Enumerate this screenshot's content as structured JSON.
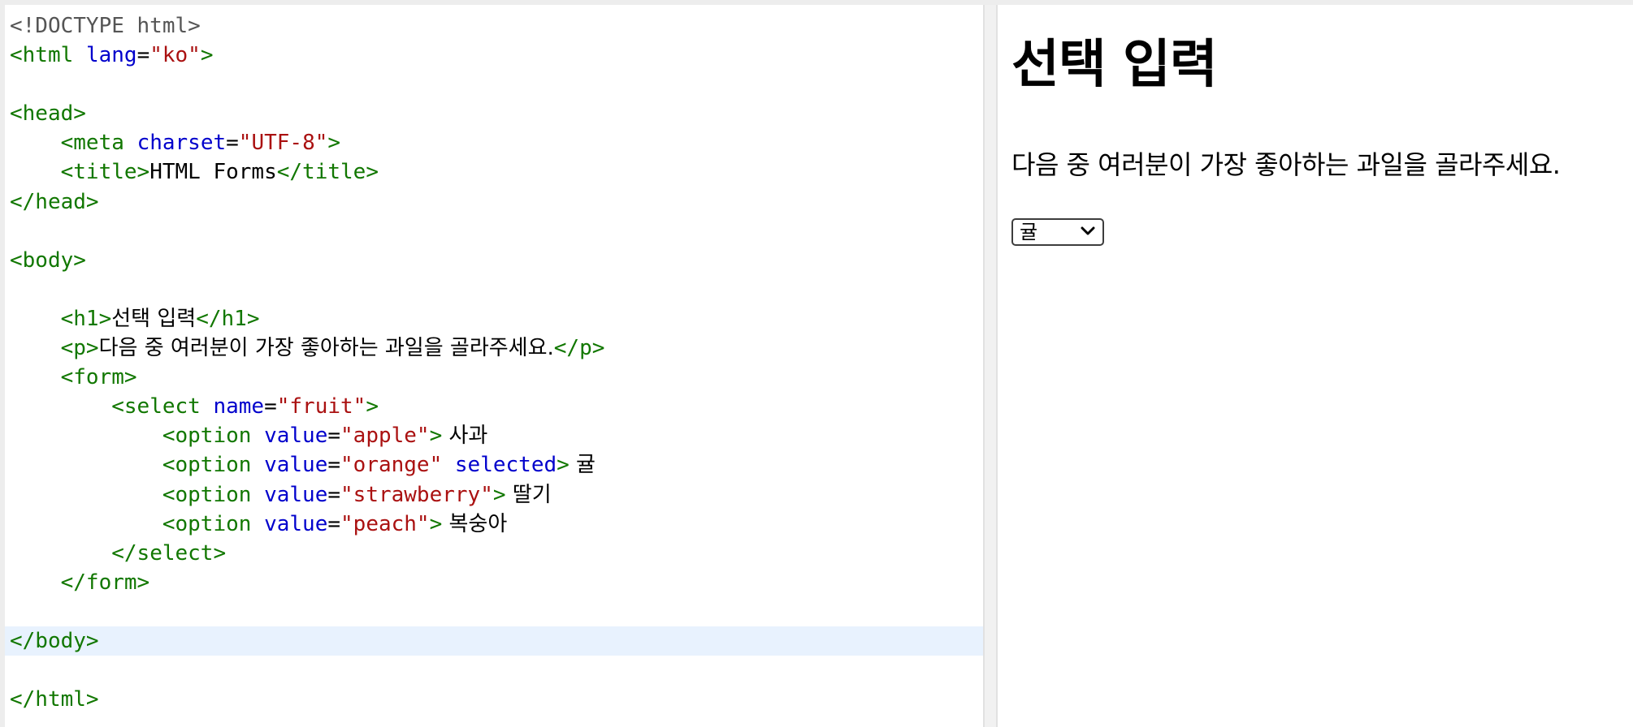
{
  "editor": {
    "lines": [
      [
        {
          "c": "t-doc",
          "t": "<!DOCTYPE html>"
        }
      ],
      [
        {
          "c": "t-tag",
          "t": "<html"
        },
        {
          "c": "t-plain",
          "t": " "
        },
        {
          "c": "t-attr",
          "t": "lang"
        },
        {
          "c": "t-plain",
          "t": "="
        },
        {
          "c": "t-str",
          "t": "\"ko\""
        },
        {
          "c": "t-tag",
          "t": ">"
        }
      ],
      [],
      [
        {
          "c": "t-tag",
          "t": "<head>"
        }
      ],
      [
        {
          "c": "t-plain",
          "t": "    "
        },
        {
          "c": "t-tag",
          "t": "<meta"
        },
        {
          "c": "t-plain",
          "t": " "
        },
        {
          "c": "t-attr",
          "t": "charset"
        },
        {
          "c": "t-plain",
          "t": "="
        },
        {
          "c": "t-str",
          "t": "\"UTF-8\""
        },
        {
          "c": "t-tag",
          "t": ">"
        }
      ],
      [
        {
          "c": "t-plain",
          "t": "    "
        },
        {
          "c": "t-tag",
          "t": "<title>"
        },
        {
          "c": "t-plain",
          "t": "HTML Forms"
        },
        {
          "c": "t-tag",
          "t": "</title>"
        }
      ],
      [
        {
          "c": "t-tag",
          "t": "</head>"
        }
      ],
      [],
      [
        {
          "c": "t-tag",
          "t": "<body>"
        }
      ],
      [],
      [
        {
          "c": "t-plain",
          "t": "    "
        },
        {
          "c": "t-tag",
          "t": "<h1>"
        },
        {
          "c": "t-txt",
          "t": "선택 입력"
        },
        {
          "c": "t-tag",
          "t": "</h1>"
        }
      ],
      [
        {
          "c": "t-plain",
          "t": "    "
        },
        {
          "c": "t-tag",
          "t": "<p>"
        },
        {
          "c": "t-txt",
          "t": "다음 중 여러분이 가장 좋아하는 과일을 골라주세요."
        },
        {
          "c": "t-tag",
          "t": "</p>"
        }
      ],
      [
        {
          "c": "t-plain",
          "t": "    "
        },
        {
          "c": "t-tag",
          "t": "<form>"
        }
      ],
      [
        {
          "c": "t-plain",
          "t": "        "
        },
        {
          "c": "t-tag",
          "t": "<select"
        },
        {
          "c": "t-plain",
          "t": " "
        },
        {
          "c": "t-attr",
          "t": "name"
        },
        {
          "c": "t-plain",
          "t": "="
        },
        {
          "c": "t-str",
          "t": "\"fruit\""
        },
        {
          "c": "t-tag",
          "t": ">"
        }
      ],
      [
        {
          "c": "t-plain",
          "t": "            "
        },
        {
          "c": "t-tag",
          "t": "<option"
        },
        {
          "c": "t-plain",
          "t": " "
        },
        {
          "c": "t-attr",
          "t": "value"
        },
        {
          "c": "t-plain",
          "t": "="
        },
        {
          "c": "t-str",
          "t": "\"apple\""
        },
        {
          "c": "t-tag",
          "t": ">"
        },
        {
          "c": "t-txt",
          "t": " 사과"
        }
      ],
      [
        {
          "c": "t-plain",
          "t": "            "
        },
        {
          "c": "t-tag",
          "t": "<option"
        },
        {
          "c": "t-plain",
          "t": " "
        },
        {
          "c": "t-attr",
          "t": "value"
        },
        {
          "c": "t-plain",
          "t": "="
        },
        {
          "c": "t-str",
          "t": "\"orange\""
        },
        {
          "c": "t-plain",
          "t": " "
        },
        {
          "c": "t-attr",
          "t": "selected"
        },
        {
          "c": "t-tag",
          "t": ">"
        },
        {
          "c": "t-txt",
          "t": " 귤"
        }
      ],
      [
        {
          "c": "t-plain",
          "t": "            "
        },
        {
          "c": "t-tag",
          "t": "<option"
        },
        {
          "c": "t-plain",
          "t": " "
        },
        {
          "c": "t-attr",
          "t": "value"
        },
        {
          "c": "t-plain",
          "t": "="
        },
        {
          "c": "t-str",
          "t": "\"strawberry\""
        },
        {
          "c": "t-tag",
          "t": ">"
        },
        {
          "c": "t-txt",
          "t": " 딸기"
        }
      ],
      [
        {
          "c": "t-plain",
          "t": "            "
        },
        {
          "c": "t-tag",
          "t": "<option"
        },
        {
          "c": "t-plain",
          "t": " "
        },
        {
          "c": "t-attr",
          "t": "value"
        },
        {
          "c": "t-plain",
          "t": "="
        },
        {
          "c": "t-str",
          "t": "\"peach\""
        },
        {
          "c": "t-tag",
          "t": ">"
        },
        {
          "c": "t-txt",
          "t": " 복숭아"
        }
      ],
      [
        {
          "c": "t-plain",
          "t": "        "
        },
        {
          "c": "t-tag",
          "t": "</select>"
        }
      ],
      [
        {
          "c": "t-plain",
          "t": "    "
        },
        {
          "c": "t-tag",
          "t": "</form>"
        }
      ],
      [],
      [
        {
          "c": "t-tag",
          "t": "</body>"
        }
      ],
      [],
      [
        {
          "c": "t-tag",
          "t": "</html>"
        }
      ]
    ],
    "active_line": 21
  },
  "preview": {
    "heading": "선택 입력",
    "paragraph": "다음 중 여러분이 가장 좋아하는 과일을 골라주세요.",
    "select": {
      "selected": "귤",
      "icon": "chevron-down-icon"
    }
  },
  "colors": {
    "tag": "#117700",
    "attribute": "#0000cc",
    "string": "#aa1111",
    "doctype": "#555555",
    "active_line": "#e8f2fe"
  }
}
